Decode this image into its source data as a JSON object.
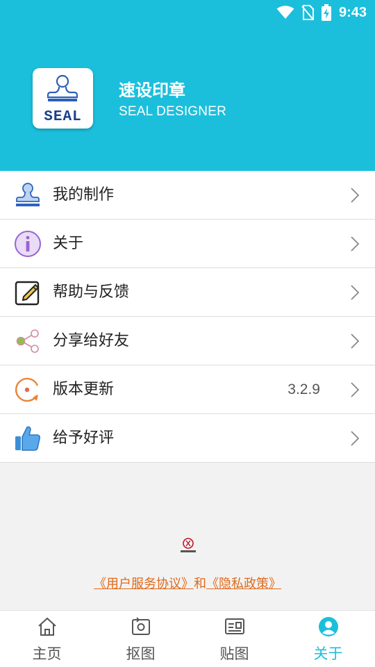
{
  "status_bar": {
    "time": "9:43",
    "icons": [
      "wifi-icon",
      "no-sim-icon",
      "battery-charging-icon"
    ]
  },
  "app": {
    "title": "速设印章",
    "subtitle": "SEAL DESIGNER",
    "logo_text": "SEAL"
  },
  "menu": {
    "items": [
      {
        "label": "我的制作",
        "icon": "stamp-icon",
        "value": ""
      },
      {
        "label": "关于",
        "icon": "info-icon",
        "value": ""
      },
      {
        "label": "帮助与反馈",
        "icon": "edit-icon",
        "value": ""
      },
      {
        "label": "分享给好友",
        "icon": "share-icon",
        "value": ""
      },
      {
        "label": "版本更新",
        "icon": "update-icon",
        "value": "3.2.9"
      },
      {
        "label": "给予好评",
        "icon": "thumbs-up-icon",
        "value": ""
      }
    ]
  },
  "footer": {
    "user_agreement": "《用户服务协议》",
    "connector": "和",
    "privacy_policy": "《隐私政策》"
  },
  "bottom_nav": {
    "items": [
      {
        "label": "主页",
        "icon": "home-icon",
        "active": false
      },
      {
        "label": "抠图",
        "icon": "crop-icon",
        "active": false
      },
      {
        "label": "贴图",
        "icon": "sticker-icon",
        "active": false
      },
      {
        "label": "关于",
        "icon": "user-icon",
        "active": true
      }
    ]
  },
  "colors": {
    "primary": "#1bbfdc",
    "link": "#e06a1a",
    "background": "#f2f2f2"
  }
}
